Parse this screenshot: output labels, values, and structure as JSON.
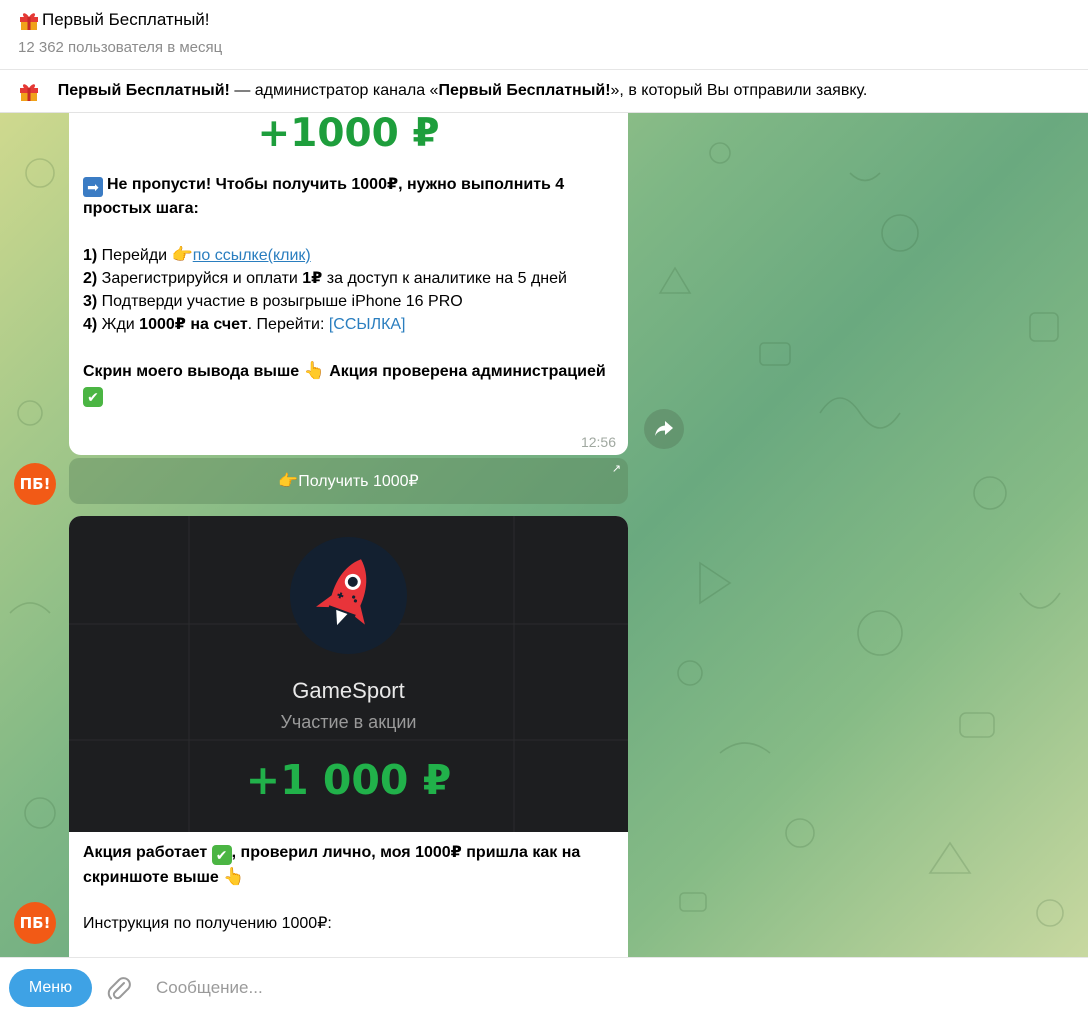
{
  "header": {
    "title": "Первый Бесплатный!",
    "subtitle": "12 362 пользователя в месяц"
  },
  "banner": {
    "name": "Первый Бесплатный!",
    "text_mid": " — администратор канала «",
    "channel": "Первый Бесплатный!",
    "text_end": "», в который Вы отправили заявку."
  },
  "message1": {
    "amount": "+1000 ₽",
    "intro_bold": "Не пропусти! Чтобы получить 1000₽, нужно выполнить 4 простых шага:",
    "step1_num": "1)",
    "step1_text": " Перейди ",
    "step1_link": "по ссылке(клик)",
    "step2_num": "2)",
    "step2_a": " Зарегистрируйся и оплати ",
    "step2_bold": "1₽",
    "step2_b": " за доступ к аналитике на 5 дней",
    "step3_num": "3)",
    "step3_text": " Подтверди участие в розыгрыше iPhone 16 PRO",
    "step4_num": "4)",
    "step4_a": " Жди ",
    "step4_bold": "1000₽ на счет",
    "step4_b": ". Перейти: ",
    "step4_link": "[ССЫЛКА]",
    "outro_a": "Скрин моего вывода выше ",
    "outro_b": " Акция проверена администрацией ",
    "time": "12:56"
  },
  "inline_button": {
    "label": "👉Получить 1000₽"
  },
  "avatar": {
    "initials": "ПБ!"
  },
  "message2": {
    "app_name": "GameSport",
    "app_sub": "Участие в акции",
    "media_amount": "+1 000 ₽",
    "text_a": "Акция работает ",
    "text_b": ", проверил лично, моя 1000₽ пришла как на скриншоте выше ",
    "instruction": "Инструкция по получению 1000₽:"
  },
  "composer": {
    "menu_label": "Меню",
    "placeholder": "Сообщение..."
  },
  "colors": {
    "accent": "#3ea2e5",
    "amount_green": "#1e9e3c",
    "avatar_orange": "#f25a16",
    "link_blue": "#2a7ebf"
  },
  "icons": [
    "gift-icon",
    "arrow-right-icon",
    "pointing-hand-icon",
    "pointing-up-icon",
    "check-mark-icon",
    "share-icon",
    "external-link-icon",
    "rocket-gamepad-icon",
    "paperclip-icon"
  ]
}
